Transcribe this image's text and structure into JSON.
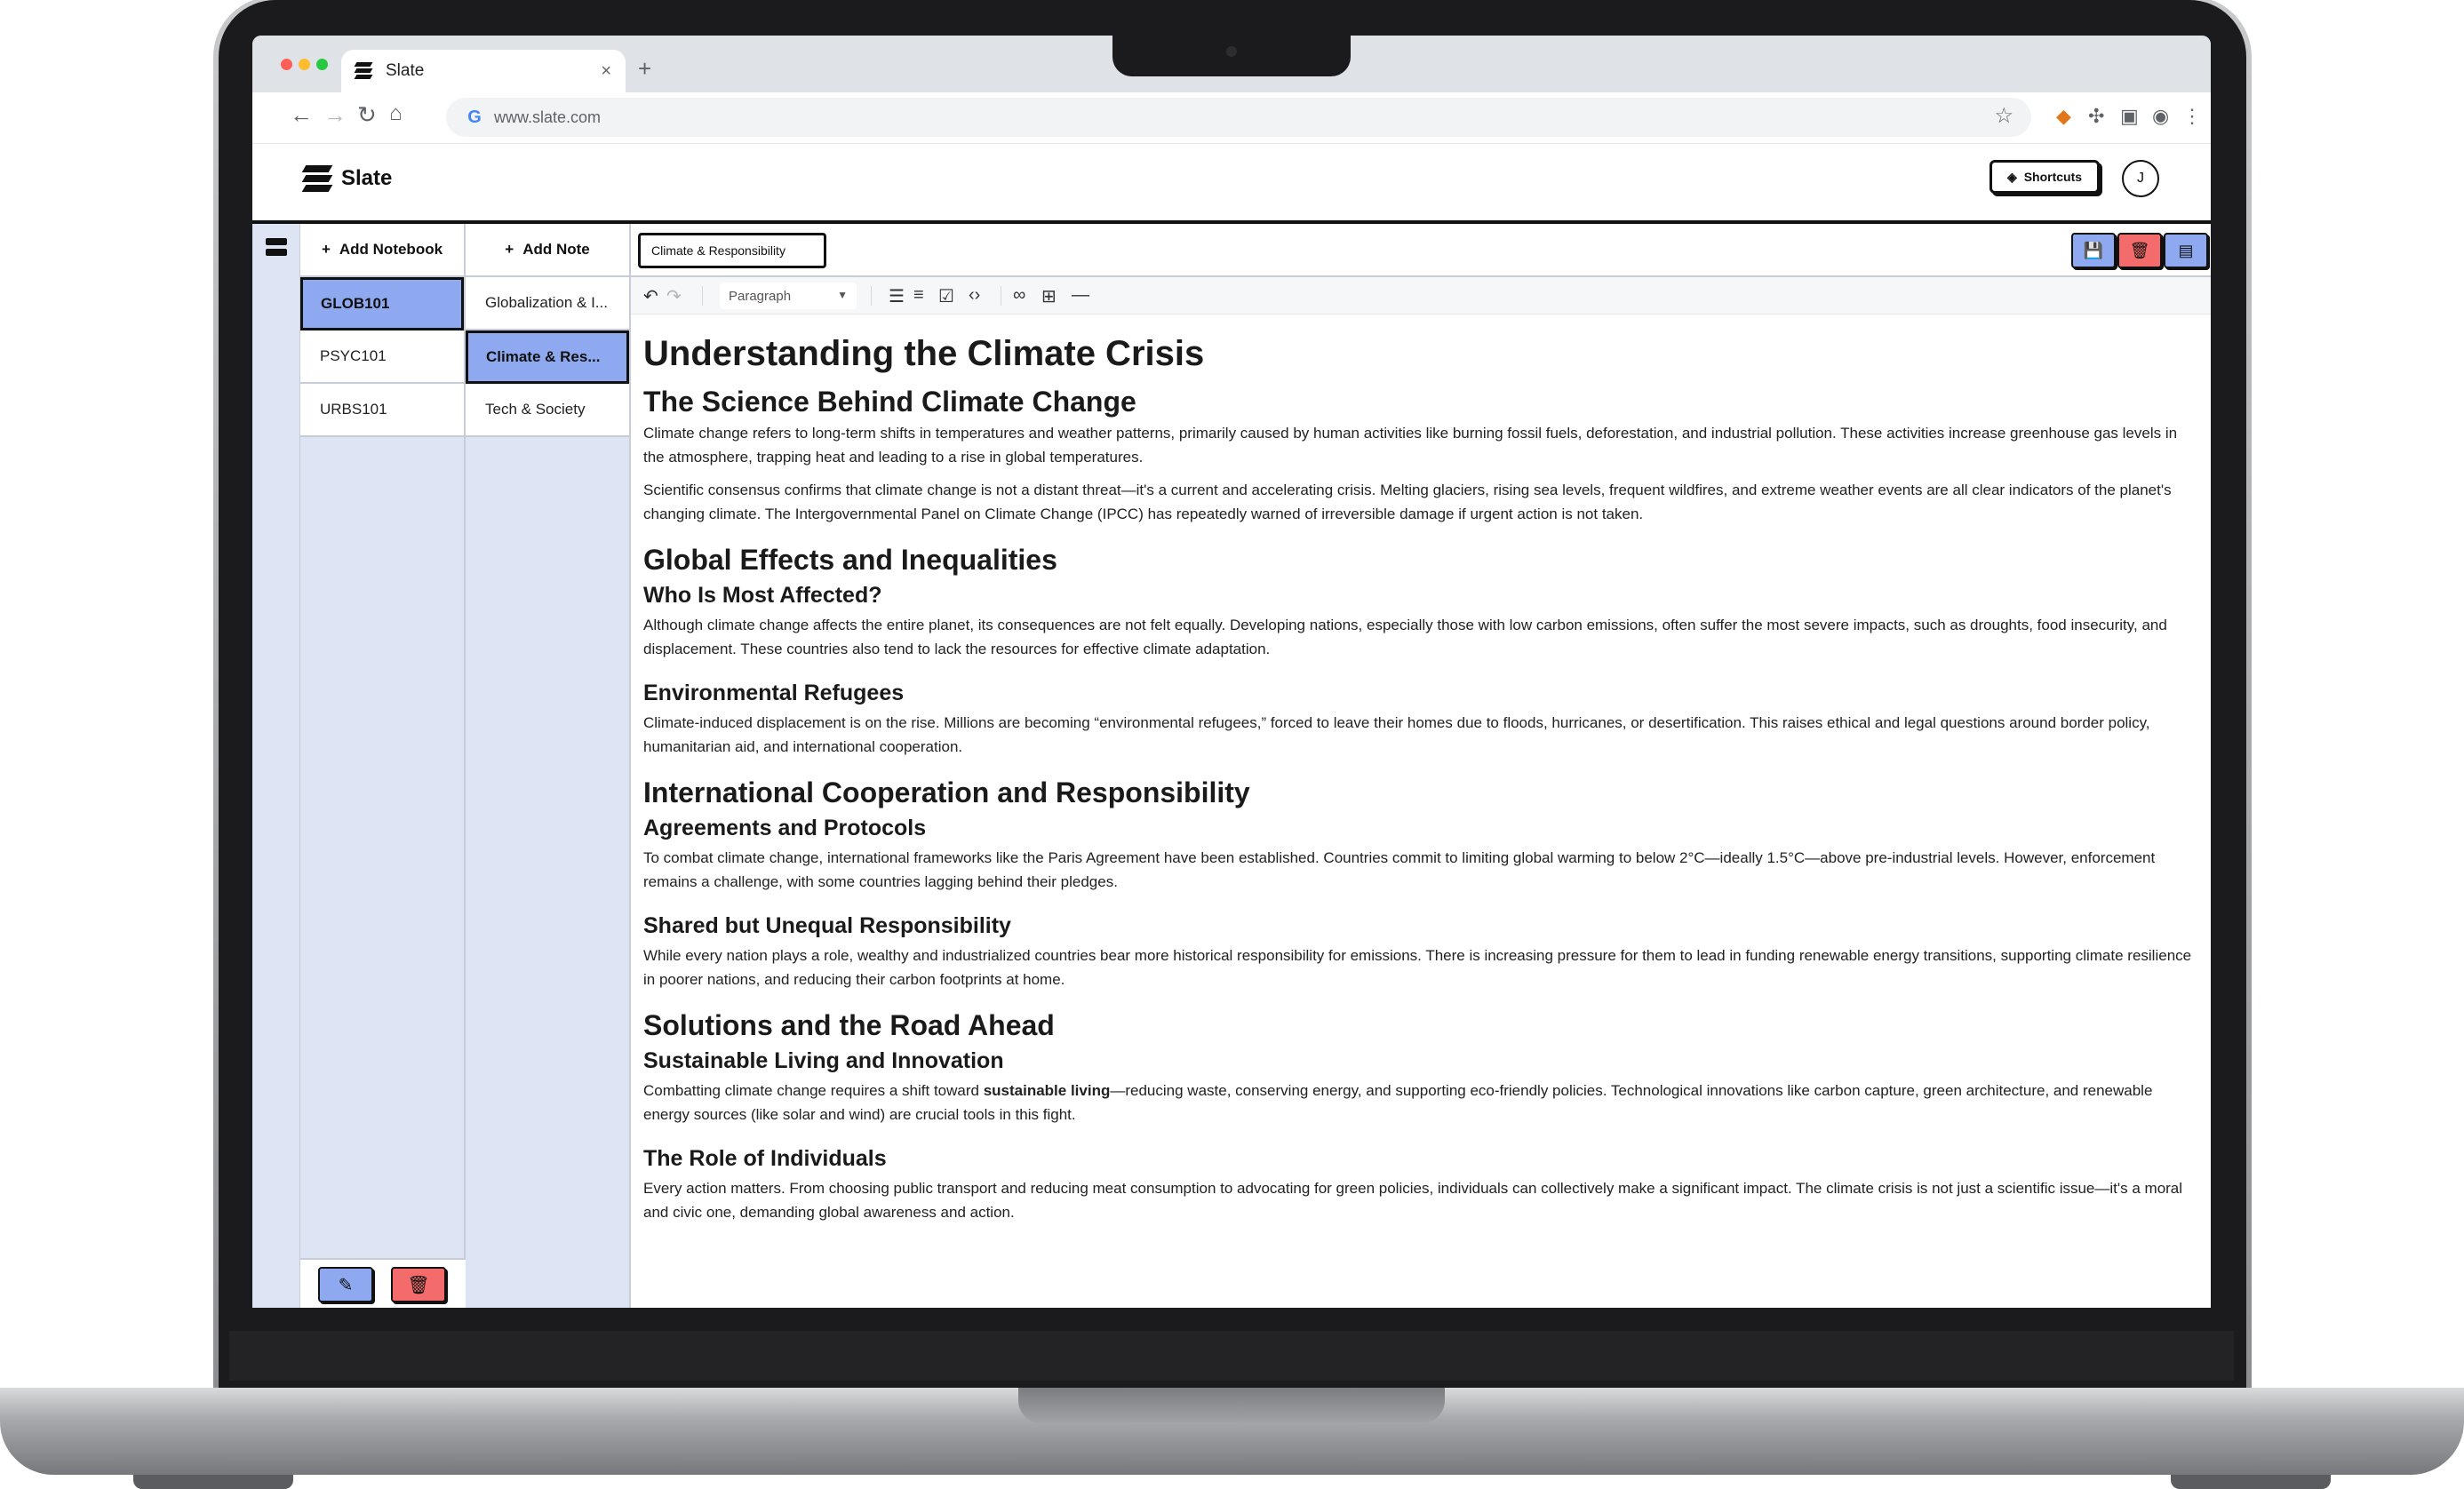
{
  "browser": {
    "tab_title": "Slate",
    "tab_close": "×",
    "new_tab": "+",
    "url": "www.slate.com"
  },
  "app": {
    "brand_name": "Slate",
    "shortcuts_label": "Shortcuts",
    "avatar_initial": "J"
  },
  "notebooks": {
    "add_label": "Add Notebook",
    "items": [
      "GLOB101",
      "PSYC101",
      "URBS101"
    ],
    "active_index": 0
  },
  "notes": {
    "add_label": "Add Note",
    "items": [
      "Globalization & I...",
      "Climate & Res...",
      "Tech & Society"
    ],
    "active_index": 1
  },
  "editor": {
    "title_value": "Climate & Responsibility",
    "block_type": "Paragraph"
  },
  "colors": {
    "accent_blue": "#8ea9ef",
    "danger_red": "#f36b6b",
    "panel_bg": "#dde4f4"
  },
  "doc": {
    "h1": "Understanding the Climate Crisis",
    "s1_h2": "The Science Behind Climate Change",
    "s1_p1": "Climate change refers to long-term shifts in temperatures and weather patterns, primarily caused by human activities like burning fossil fuels, deforestation, and industrial pollution. These activities increase greenhouse gas levels in the atmosphere, trapping heat and leading to a rise in global temperatures.",
    "s1_p2": "Scientific consensus confirms that climate change is not a distant threat—it's a current and accelerating crisis. Melting glaciers, rising sea levels, frequent wildfires, and extreme weather events are all clear indicators of the planet's changing climate. The Intergovernmental Panel on Climate Change (IPCC) has repeatedly warned of irreversible damage if urgent action is not taken.",
    "s2_h2": "Global Effects and Inequalities",
    "s2_h3a": "Who Is Most Affected?",
    "s2_p1": "Although climate change affects the entire planet, its consequences are not felt equally. Developing nations, especially those with low carbon emissions, often suffer the most severe impacts, such as droughts, food insecurity, and displacement. These countries also tend to lack the resources for effective climate adaptation.",
    "s2_h3b": "Environmental Refugees",
    "s2_p2": "Climate-induced displacement is on the rise. Millions are becoming “environmental refugees,” forced to leave their homes due to floods, hurricanes, or desertification. This raises ethical and legal questions around border policy, humanitarian aid, and international cooperation.",
    "s3_h2": "International Cooperation and Responsibility",
    "s3_h3a": "Agreements and Protocols",
    "s3_p1": "To combat climate change, international frameworks like the Paris Agreement have been established. Countries commit to limiting global warming to below 2°C—ideally 1.5°C—above pre-industrial levels. However, enforcement remains a challenge, with some countries lagging behind their pledges.",
    "s3_h3b": "Shared but Unequal Responsibility",
    "s3_p2": "While every nation plays a role, wealthy and industrialized countries bear more historical responsibility for emissions. There is increasing pressure for them to lead in funding renewable energy transitions, supporting climate resilience in poorer nations, and reducing their carbon footprints at home.",
    "s4_h2": "Solutions and the Road Ahead",
    "s4_h3a": "Sustainable Living and Innovation",
    "s4_p1_pre": "Combatting climate change requires a shift toward ",
    "s4_p1_bold": "sustainable living",
    "s4_p1_post": "—reducing waste, conserving energy, and supporting eco-friendly policies. Technological innovations like carbon capture, green architecture, and renewable energy sources (like solar and wind) are crucial tools in this fight.",
    "s4_h3b": "The Role of Individuals",
    "s4_p2": "Every action matters. From choosing public transport and reducing meat consumption to advocating for green policies, individuals can collectively make a significant impact. The climate crisis is not just a scientific issue—it's a moral and civic one, demanding global awareness and action."
  }
}
